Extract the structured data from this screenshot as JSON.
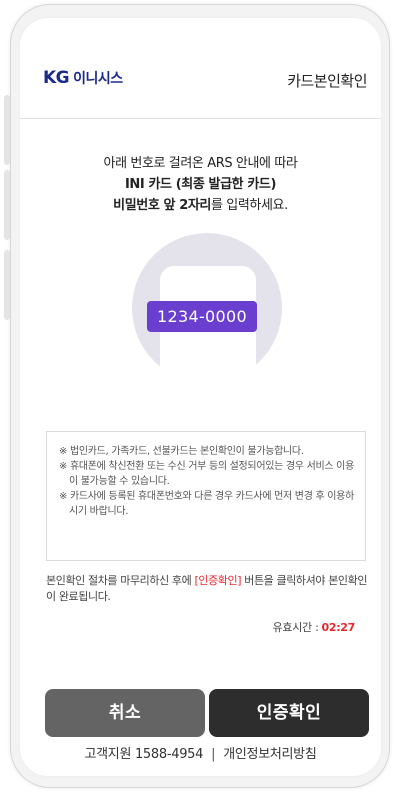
{
  "header": {
    "logo_kg": "KG",
    "logo_name": "이니시스",
    "title": "카드본인확인"
  },
  "guide": {
    "line1": "아래 번호로 걸려온 ARS 안내에 따라",
    "line2": "INI 카드 (최종 발급한 카드)",
    "line3_bold": "비밀번호 앞 2자리",
    "line3_rest": "를 입력하세요."
  },
  "ars": {
    "number": "1234-0000"
  },
  "notice": {
    "items": [
      "※ 법인카드, 가족카드, 선불카드는 본인확인이 불가능합니다.",
      "※ 휴대폰에 착신전환 또는 수신 거부 등의 설정되어있는 경우 서비스 이용이 불가능할 수 있습니다.",
      "※ 카드사에 등록된 휴대폰번호와 다른 경우 카드사에 먼저 변경 후 이용하시기 바랍니다."
    ]
  },
  "info": {
    "before": "본인확인 절차를 마무리하신 후에 ",
    "highlight": "[인증확인]",
    "after": " 버튼을 클릭하셔야 본인확인이 완료됩니다."
  },
  "timer": {
    "label": "유효시간 :",
    "value": "02:27"
  },
  "buttons": {
    "cancel": "취소",
    "confirm": "인증확인"
  },
  "footer": {
    "support": "고객지원 1588-4954",
    "separator": "|",
    "privacy": "개인정보처리방침"
  },
  "colors": {
    "brand": "#1a2a8c",
    "accent": "#6a3fd0",
    "highlight": "#e6282e"
  }
}
